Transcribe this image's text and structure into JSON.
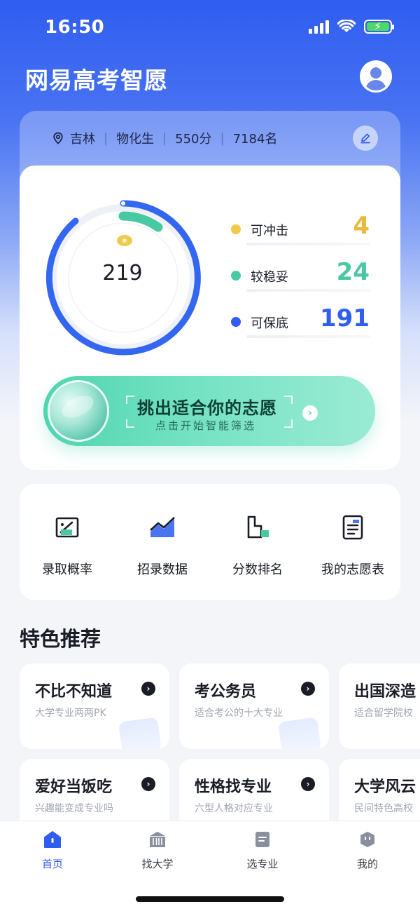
{
  "status_bar": {
    "time": "16:50"
  },
  "header": {
    "title": "网易高考智愿"
  },
  "profile": {
    "province": "吉林",
    "subjects": "物化生",
    "score": "550分",
    "rank": "7184名"
  },
  "summary": {
    "total": "219",
    "stats": [
      {
        "label": "可冲击",
        "value": "4",
        "color": "#f0c94a"
      },
      {
        "label": "较稳妥",
        "value": "24",
        "color": "#49c9a3"
      },
      {
        "label": "可保底",
        "value": "191",
        "color": "#2f5df0"
      }
    ]
  },
  "cta": {
    "title": "挑出适合你的志愿",
    "subtitle": "点击开始智能筛选"
  },
  "tools": [
    {
      "label": "录取概率",
      "icon": "probability-chart-icon"
    },
    {
      "label": "招录数据",
      "icon": "line-chart-icon"
    },
    {
      "label": "分数排名",
      "icon": "bar-rank-icon"
    },
    {
      "label": "我的志愿表",
      "icon": "document-icon"
    }
  ],
  "section": {
    "title": "特色推荐"
  },
  "recommendations": [
    {
      "title": "不比不知道",
      "subtitle": "大学专业两两PK"
    },
    {
      "title": "考公务员",
      "subtitle": "适合考公的十大专业"
    },
    {
      "title": "出国深造",
      "subtitle": "适合留学院校"
    },
    {
      "title": "爱好当饭吃",
      "subtitle": "兴趣能变成专业吗"
    },
    {
      "title": "性格找专业",
      "subtitle": "六型人格对应专业"
    },
    {
      "title": "大学风云",
      "subtitle": "民间特色高校"
    }
  ],
  "tabbar": [
    {
      "label": "首页",
      "active": true
    },
    {
      "label": "找大学",
      "active": false
    },
    {
      "label": "选专业",
      "active": false
    },
    {
      "label": "我的",
      "active": false
    }
  ]
}
